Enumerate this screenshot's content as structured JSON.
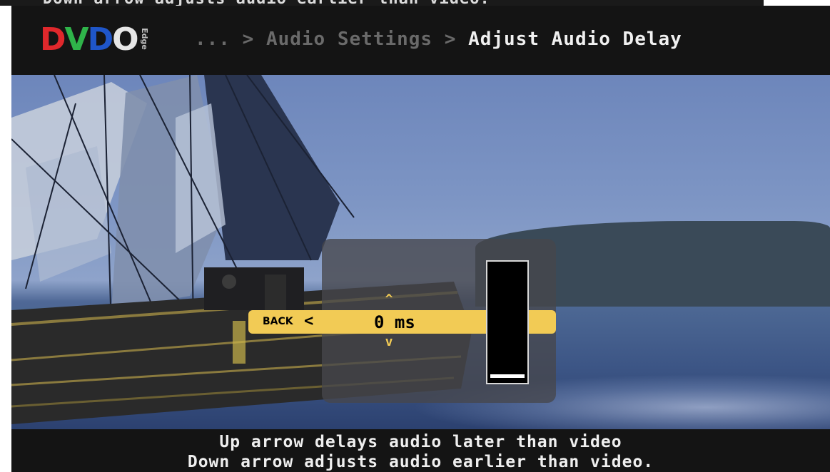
{
  "top_strip": {
    "text": "Down arrow adjusts audio earlier than video."
  },
  "header": {
    "logo": {
      "letters": [
        {
          "char": "D",
          "color": "#e0282c"
        },
        {
          "char": "V",
          "color": "#2fb44a"
        },
        {
          "char": "D",
          "color": "#1f56c9"
        },
        {
          "char": "O",
          "color": "#e6e6e6"
        }
      ],
      "subtext": "Edge"
    },
    "breadcrumb": {
      "ellipsis": "...",
      "separator": ">",
      "parent": "Audio Settings",
      "current": "Adjust Audio Delay"
    }
  },
  "control": {
    "back_label": "BACK",
    "back_glyph": "<",
    "up_glyph": "^",
    "down_glyph": "v",
    "value": "0 ms",
    "meter_level": 0.0
  },
  "footer": {
    "line1": "Up arrow delays audio later than video",
    "line2": "Down arrow adjusts audio earlier than video."
  },
  "colors": {
    "accent": "#f2cb55",
    "header_bg": "#141414"
  }
}
